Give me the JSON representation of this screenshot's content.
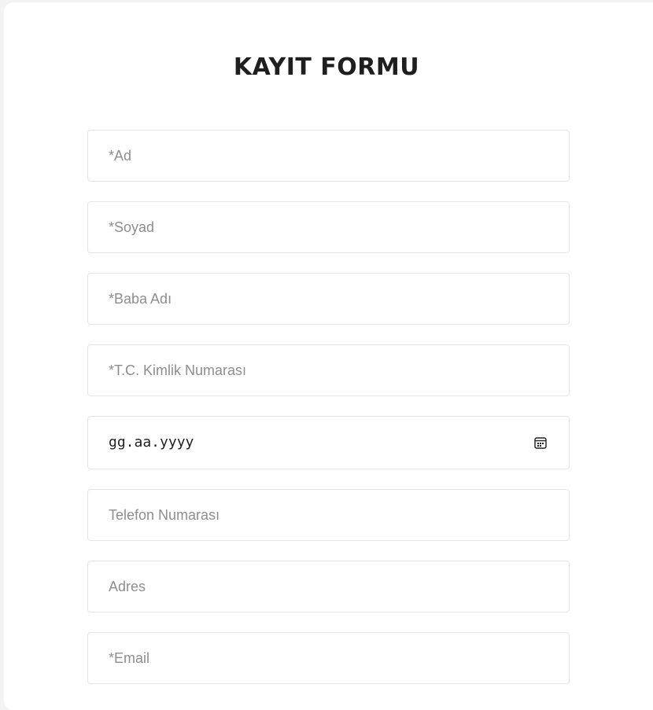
{
  "form": {
    "title": "KAYIT FORMU",
    "fields": {
      "first_name": {
        "placeholder": "*Ad"
      },
      "last_name": {
        "placeholder": "*Soyad"
      },
      "father_name": {
        "placeholder": "*Baba Adı"
      },
      "tc_id": {
        "placeholder": "*T.C. Kimlik Numarası"
      },
      "birth_date": {
        "display": "gg.aa.yyyy",
        "icon": "calendar-icon"
      },
      "phone": {
        "placeholder": "Telefon Numarası"
      },
      "address": {
        "placeholder": "Adres"
      },
      "email": {
        "placeholder": "*Email"
      }
    }
  }
}
